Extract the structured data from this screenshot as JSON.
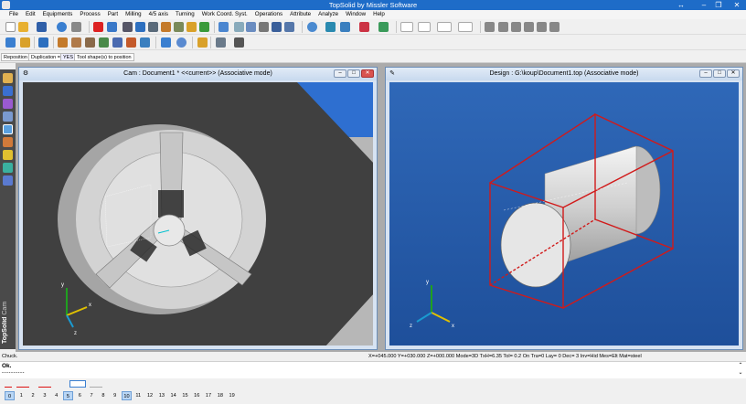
{
  "app": {
    "title": "TopSolid by Missler Software"
  },
  "window_controls": {
    "restore": "↔",
    "minimize": "–",
    "maximize": "❐",
    "close": "✕"
  },
  "menu": [
    "File",
    "Edit",
    "Equipments",
    "Process",
    "Part",
    "Milling",
    "4/5 axis",
    "Turning",
    "Work Coord. Syst.",
    "Operations",
    "Attribute",
    "Analyze",
    "Window",
    "Help"
  ],
  "optionbar": {
    "reposition": "Reposition",
    "duplication": "Duplication =",
    "yes": "YES",
    "tool_shape": "Tool shape(s) to position"
  },
  "cam_window": {
    "title": "Cam : Document1 * <<current>> (Associative mode)",
    "icon": "cam-window-icon",
    "axes": {
      "x": "x",
      "y": "y",
      "z": "z"
    }
  },
  "design_window": {
    "title": "Design : G:\\koup\\Document1.top (Associative mode)",
    "icon": "design-window-icon",
    "axes": {
      "x": "x",
      "y": "y",
      "z": "z"
    }
  },
  "window_buttons": {
    "minimize": "–",
    "maximize": "□",
    "close": "✕"
  },
  "brand": {
    "name": "TopSolid",
    "module": "Cam"
  },
  "status": {
    "prompt": "Chuck.",
    "readout": "X=+045.000  Y=+030.000  Z=+000.000  Mode=3D  TxH=6.35  Tol=  0.2  On  Tra=0  Lay= 0  Dec= 3  Inv=Hid  Mes=Elt  Mat=steel"
  },
  "command": {
    "ok": "Ok.",
    "dashes": "----------",
    "scroll_up": "⌃",
    "scroll_down": "⌄"
  },
  "layers": {
    "items": [
      "0",
      "1",
      "2",
      "3",
      "4",
      "5",
      "6",
      "7",
      "8",
      "9",
      "10",
      "11",
      "12",
      "13",
      "14",
      "15",
      "16",
      "17",
      "18",
      "19"
    ],
    "active": [
      "0",
      "5",
      "10"
    ]
  },
  "colors": {
    "titlebar": "#1e6cc8",
    "design_bg": "#2b62b0",
    "cam_bg": "#4a4a4a",
    "bbox_red": "#d11a1a"
  }
}
